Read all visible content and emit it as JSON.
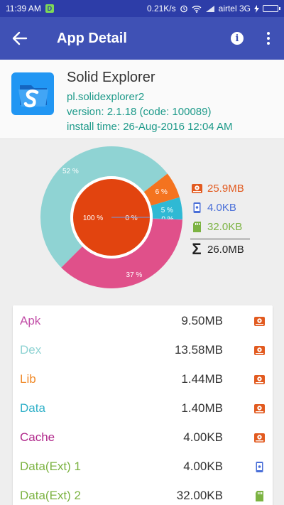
{
  "status_bar": {
    "time": "11:39 AM",
    "notification_badge": "D",
    "net_speed": "0.21K/s",
    "carrier": "airtel 3G",
    "icons": [
      "alarm-icon",
      "wifi-icon",
      "signal-icon",
      "battery-charging-icon"
    ]
  },
  "app_bar": {
    "title": "App Detail",
    "back_icon": "arrow-back-icon",
    "info_icon": "info-icon",
    "more_icon": "more-vert-icon",
    "color": "#3f51b5"
  },
  "app": {
    "name": "Solid Explorer",
    "package": "pl.solidexplorer2",
    "version": "version: 2.1.18 (code: 100089)",
    "install_time": "install time: 26-Aug-2016 12:04 AM"
  },
  "chart_data": {
    "type": "pie",
    "outer_ring": [
      {
        "label": "52 %",
        "value": 52,
        "color": "#8fd3d3"
      },
      {
        "label": "6 %",
        "value": 6,
        "color": "#f4731f"
      },
      {
        "label": "5 %",
        "value": 5,
        "color": "#2fb9d4"
      },
      {
        "label": "0 %",
        "value": 0.1,
        "color": "#6f9be8"
      },
      {
        "label": "37 %",
        "value": 37,
        "color": "#e0508a"
      }
    ],
    "inner_circle": [
      {
        "label": "100 %",
        "value": 100,
        "color": "#e2440f"
      },
      {
        "label": "0 %",
        "value": 0,
        "color": "#6f9be8"
      }
    ]
  },
  "legend": {
    "internal": {
      "value": "25.9MB",
      "color": "#e25a1f",
      "icon": "storage-internal-icon"
    },
    "app": {
      "value": "4.0KB",
      "color": "#4a6fd8",
      "icon": "phone-storage-icon"
    },
    "sd": {
      "value": "32.0KB",
      "color": "#7cb342",
      "icon": "sd-card-icon"
    },
    "total": {
      "value": "26.0MB",
      "symbol": "Σ",
      "color": "#222222"
    }
  },
  "rows": [
    {
      "label": "Apk",
      "value": "9.50MB",
      "color": "#c24fa8",
      "icon": "storage-internal-icon"
    },
    {
      "label": "Dex",
      "value": "13.58MB",
      "color": "#8fd3d3",
      "icon": "storage-internal-icon"
    },
    {
      "label": "Lib",
      "value": "1.44MB",
      "color": "#f08a2a",
      "icon": "storage-internal-icon"
    },
    {
      "label": "Data",
      "value": "1.40MB",
      "color": "#2fb0c8",
      "icon": "storage-internal-icon"
    },
    {
      "label": "Cache",
      "value": "4.00KB",
      "color": "#b0278a",
      "icon": "storage-internal-icon"
    },
    {
      "label": "Data(Ext) 1",
      "value": "4.00KB",
      "color": "#7cb342",
      "icon": "phone-storage-icon"
    },
    {
      "label": "Data(Ext) 2",
      "value": "32.00KB",
      "color": "#7cb342",
      "icon": "sd-card-icon"
    }
  ]
}
